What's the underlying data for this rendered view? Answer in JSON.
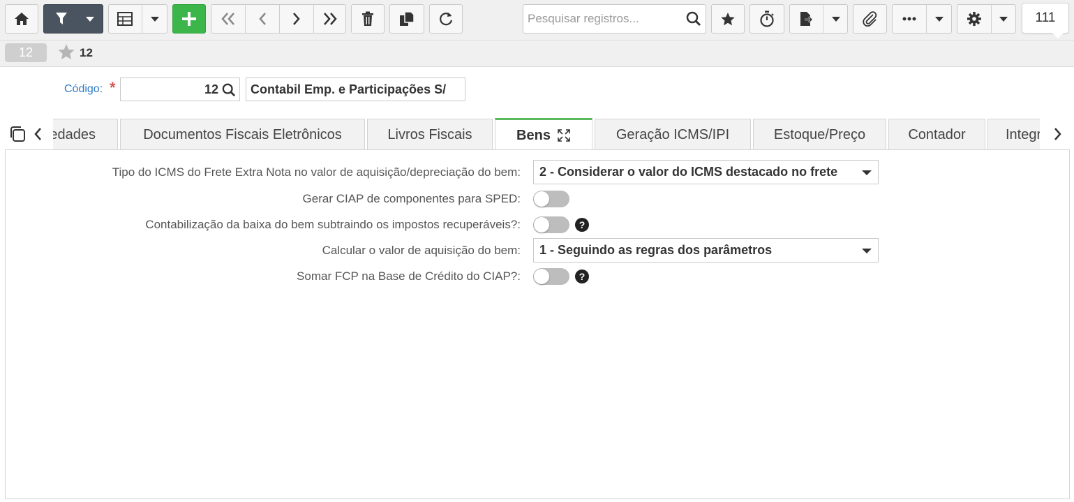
{
  "toolbar": {
    "search_placeholder": "Pesquisar registros...",
    "record_counter": "111",
    "icons": [
      "home-icon",
      "filter-icon",
      "chevron-down-icon",
      "grid-icon",
      "plus-icon",
      "first-icon",
      "prev-icon",
      "next-icon",
      "last-icon",
      "trash-icon",
      "copy-icon",
      "refresh-icon",
      "search-icon",
      "star-icon",
      "stopwatch-icon",
      "export-icon",
      "paperclip-icon",
      "ellipsis-icon",
      "gear-icon"
    ]
  },
  "record_bar": {
    "badge": "12",
    "favorite_id": "12"
  },
  "header": {
    "code_label": "Código:",
    "required_mark": "*",
    "code_value": "12",
    "name_value": "Contabil Emp. e Participações S/"
  },
  "tabs": [
    {
      "label": "Propriedades",
      "active": false
    },
    {
      "label": "Documentos Fiscais Eletrônicos",
      "active": false
    },
    {
      "label": "Livros Fiscais",
      "active": false
    },
    {
      "label": "Bens",
      "active": true
    },
    {
      "label": "Geração ICMS/IPI",
      "active": false
    },
    {
      "label": "Estoque/Preço",
      "active": false
    },
    {
      "label": "Contador",
      "active": false
    },
    {
      "label": "Integração",
      "active": false
    }
  ],
  "form": {
    "fields": [
      {
        "label": "Tipo do ICMS do Frete Extra Nota no valor de aquisição/depreciação do bem:",
        "type": "select",
        "value": "2 - Considerar o valor do ICMS destacado no frete"
      },
      {
        "label": "Gerar CIAP de componentes para SPED:",
        "type": "toggle",
        "value": false
      },
      {
        "label": "Contabilização da baixa do bem subtraindo os impostos recuperáveis?:",
        "type": "toggle",
        "value": false,
        "help": "?"
      },
      {
        "label": "Calcular o valor de aquisição do bem:",
        "type": "select",
        "value": "1 - Seguindo as regras dos parâmetros"
      },
      {
        "label": "Somar FCP na Base de Crédito do CIAP?:",
        "type": "toggle",
        "value": false,
        "help": "?"
      }
    ]
  },
  "colors": {
    "accent": "#2f7bc4",
    "active_tab": "#5cb85c",
    "add_button": "#3cb64a",
    "filter_button": "#4a5360",
    "required": "#d9534f"
  }
}
